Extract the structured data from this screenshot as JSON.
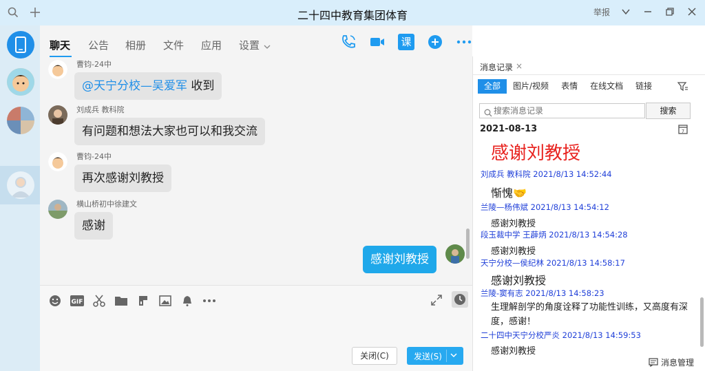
{
  "window": {
    "title": "二十四中教育集团体育",
    "report_label": "举报"
  },
  "tabs": [
    {
      "label": "聊天"
    },
    {
      "label": "公告"
    },
    {
      "label": "相册"
    },
    {
      "label": "文件"
    },
    {
      "label": "应用"
    },
    {
      "label": "设置"
    }
  ],
  "header_tools": {
    "course_label": "课"
  },
  "messages": [
    {
      "sender": "曹钧-24中",
      "mention": "@天宁分校—吴爱军",
      "text": " 收到"
    },
    {
      "sender": "刘成兵  教科院",
      "text": "有问题和想法大家也可以和我交流"
    },
    {
      "sender": "曹钧-24中",
      "text": "再次感谢刘教授"
    },
    {
      "sender": "横山桥初中徐建文",
      "text": "感谢"
    },
    {
      "sender": "",
      "text": "感谢刘教授",
      "mine": true
    }
  ],
  "input": {
    "close_label": "关闭(C)",
    "send_label": "发送(S)"
  },
  "history": {
    "title": "消息记录",
    "close_x": "×",
    "filters": [
      "全部",
      "图片/视频",
      "表情",
      "在线文档",
      "链接"
    ],
    "search_placeholder": "搜索消息记录",
    "search_button": "搜索",
    "date": "2021-08-13",
    "records": [
      {
        "kind": "big",
        "text": "感谢刘教授"
      },
      {
        "kind": "meta",
        "text": "刘成兵  教科院 2021/8/13 14:52:44"
      },
      {
        "kind": "mid",
        "text": "惭愧🤝"
      },
      {
        "kind": "meta",
        "text": "兰陵—杨伟斌 2021/8/13 14:54:12"
      },
      {
        "kind": "body",
        "text": "感谢刘教授"
      },
      {
        "kind": "meta",
        "text": "段玉裁中学  王薜炳 2021/8/13 14:54:28"
      },
      {
        "kind": "body",
        "text": "感谢刘教授"
      },
      {
        "kind": "meta",
        "text": "天宁分校—侯纪林 2021/8/13 14:58:17"
      },
      {
        "kind": "mid",
        "text": "感谢刘教授"
      },
      {
        "kind": "meta",
        "text": "兰陵-窦有志 2021/8/13 14:58:23"
      },
      {
        "kind": "wrap",
        "text": "生理解剖学的角度诠释了功能性训练，又高度有深度，感谢！"
      },
      {
        "kind": "meta",
        "text": "二十四中天宁分校严炎 2021/8/13 14:59:53"
      },
      {
        "kind": "body",
        "text": "感谢刘教授"
      }
    ],
    "manage_label": "消息管理"
  },
  "colors": {
    "accent": "#1f9bf0",
    "titlebar": "#d9eefb",
    "mine_bubble": "#1fa8ea",
    "record_meta": "#1f3fd8",
    "record_highlight": "#e8231f"
  }
}
